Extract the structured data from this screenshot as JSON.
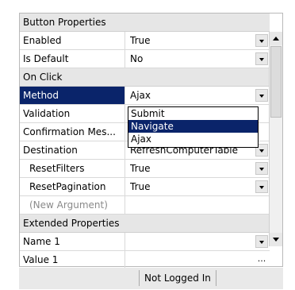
{
  "groups": {
    "button_properties": "Button Properties",
    "on_click": "On Click",
    "extended_properties": "Extended Properties"
  },
  "properties": {
    "enabled": {
      "name": "Enabled",
      "value": "True"
    },
    "is_default": {
      "name": "Is Default",
      "value": "No"
    },
    "method": {
      "name": "Method",
      "value": "Ajax"
    },
    "validation": {
      "name": "Validation",
      "value": ""
    },
    "confirmation": {
      "name": "Confirmation Mes...",
      "value": ""
    },
    "destination": {
      "name": "Destination",
      "value": "RefreshComputerTable"
    },
    "reset_filters": {
      "name": "ResetFilters",
      "value": "True"
    },
    "reset_pagination": {
      "name": "ResetPagination",
      "value": "True"
    },
    "new_argument": {
      "name": "(New Argument)",
      "value": ""
    },
    "name1": {
      "name": "Name 1",
      "value": ""
    },
    "value1": {
      "name": "Value 1",
      "value": ""
    }
  },
  "method_dropdown": {
    "options": [
      "Submit",
      "Navigate",
      "Ajax"
    ],
    "highlighted": "Navigate"
  },
  "ellipsis_label": "...",
  "status": {
    "login": "Not Logged In"
  },
  "colors": {
    "selection": "#0a246a",
    "header": "#e6e6e6",
    "statusbar": "#e9e9e9"
  }
}
